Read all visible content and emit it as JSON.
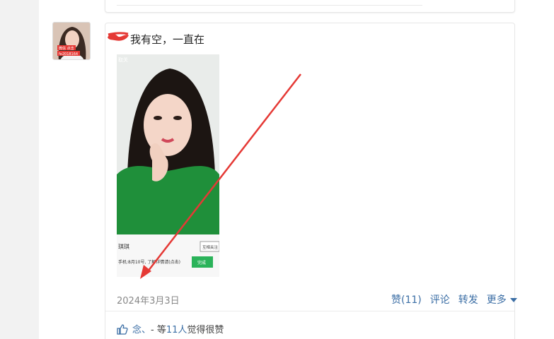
{
  "post": {
    "text": "我有空，一直在",
    "date": "2024年3月3日",
    "actions": {
      "like": "赞(11)",
      "comment": "评论",
      "share": "转发",
      "more": "更多"
    },
    "likes": {
      "name": "念、",
      "sep": " - 等",
      "count": "11人",
      "suffix": "觉得很赞"
    }
  },
  "photo": {
    "top_left": "取关",
    "name": "琪琪",
    "button": "互相关注",
    "footer_text": "手机:8月10号, 了解详情请(点击)",
    "green_button": "完成"
  },
  "avatar": {
    "text_line1": "微信 点击",
    "text_line2": "fe2018164"
  },
  "colors": {
    "accent": "#3b6ea5",
    "annotation_red": "#e53935"
  }
}
